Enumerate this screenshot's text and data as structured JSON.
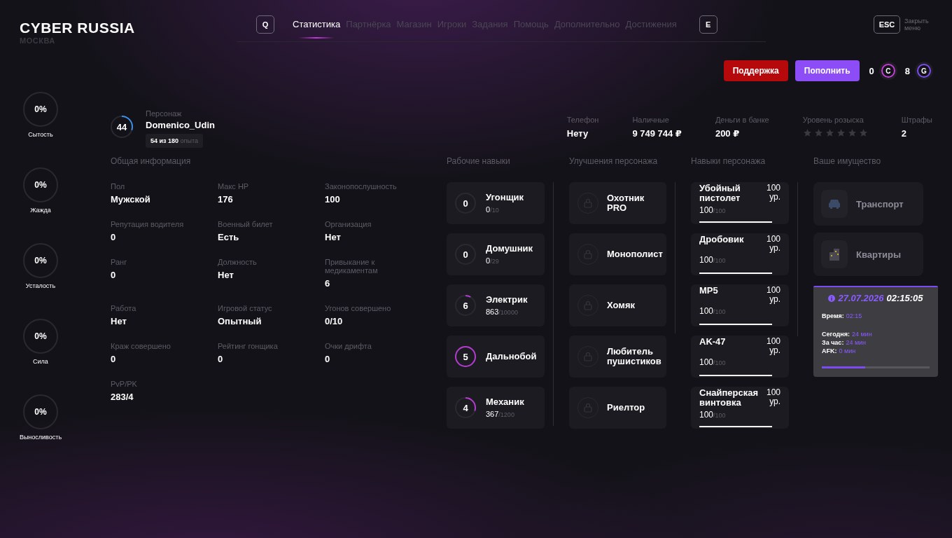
{
  "header": {
    "logo": "CYBER RUSSIA",
    "city": "МОСКВА",
    "prev_key": "Q",
    "next_key": "E",
    "close_key": "ESC",
    "close_label": "Закрыть меню",
    "tabs": [
      {
        "label": "Статистика",
        "selected": true
      },
      {
        "label": "Партнёрка",
        "selected": false
      },
      {
        "label": "Магазин",
        "selected": false
      },
      {
        "label": "Игроки",
        "selected": false
      },
      {
        "label": "Задания",
        "selected": false
      },
      {
        "label": "Помощь",
        "selected": false
      },
      {
        "label": "Дополнительно",
        "selected": false
      },
      {
        "label": "Достижения",
        "selected": false
      }
    ]
  },
  "actions": {
    "support": "Поддержка",
    "topup": "Пополнить",
    "currencies": [
      {
        "amount": "0",
        "symbol": "C",
        "color": "#c43bd8"
      },
      {
        "amount": "8",
        "symbol": "G",
        "color": "#7c4ef2"
      }
    ]
  },
  "needs": [
    {
      "value": "0%",
      "label": "Сытость",
      "level": 0
    },
    {
      "value": "0%",
      "label": "Жажда",
      "level": 0
    },
    {
      "value": "0%",
      "label": "Усталость",
      "level": 0
    },
    {
      "value": "0%",
      "label": "Сила",
      "level": 0
    },
    {
      "value": "0%",
      "label": "Выносливость",
      "level": 0
    }
  ],
  "character": {
    "label": "Персонаж",
    "name": "Domenico_Udin",
    "level_number": "44",
    "level": 0.3,
    "xp": "54 из 180",
    "xp_unit": "опыта"
  },
  "summary": [
    {
      "kind": "text",
      "label": "Телефон",
      "value": "Нету"
    },
    {
      "kind": "text",
      "label": "Наличные",
      "value": "9 749 744 ₽"
    },
    {
      "kind": "text",
      "label": "Деньги в банке",
      "value": "200 ₽"
    },
    {
      "kind": "stars",
      "label": "Уровень розыска",
      "stars": 0
    },
    {
      "kind": "text",
      "label": "Штрафы",
      "value": "2"
    }
  ],
  "general": {
    "title": "Общая информация",
    "fields": [
      {
        "label": "Пол",
        "value": "Мужской"
      },
      {
        "label": "Макс HP",
        "value": "176"
      },
      {
        "label": "Законопослушность",
        "value": "100"
      },
      {
        "label": "Репутация водителя",
        "value": "0"
      },
      {
        "label": "Военный билет",
        "value": "Есть"
      },
      {
        "label": "Организация",
        "value": "Нет"
      },
      {
        "label": "Ранг",
        "value": "0"
      },
      {
        "label": "Должность",
        "value": "Нет"
      },
      {
        "label": "Привыкание к медикаментам",
        "value": "6"
      },
      {
        "label": "Работа",
        "value": "Нет"
      },
      {
        "label": "Игровой статус",
        "value": "Опытный"
      },
      {
        "label": "Угонов совершено",
        "value": "0/10"
      },
      {
        "label": "Краж совершено",
        "value": "0"
      },
      {
        "label": "Рейтинг гонщика",
        "value": "0"
      },
      {
        "label": "Очки дрифта",
        "value": "0"
      },
      {
        "label": "PvP/PK",
        "value": "283/4"
      }
    ]
  },
  "work_skills": {
    "title": "Рабочие навыки",
    "items": [
      {
        "level_number": "0",
        "name": "Угонщик",
        "progress": "0",
        "max": "/10",
        "level": 0
      },
      {
        "level_number": "0",
        "name": "Домушник",
        "progress": "0",
        "max": "/29",
        "level": 0
      },
      {
        "level_number": "6",
        "name": "Электрик",
        "progress": "863",
        "max": "/10000",
        "level": 0.086
      },
      {
        "level_number": "5",
        "name": "Дальнобой",
        "level": 1
      },
      {
        "level_number": "4",
        "name": "Механик",
        "progress": "367",
        "max": "/1200",
        "level": 0.3
      }
    ]
  },
  "upgrades": {
    "title": "Улучшения персонажа",
    "items": [
      {
        "name": "Охотник PRO",
        "locked": true
      },
      {
        "name": "Монополист",
        "locked": true
      },
      {
        "name": "Хомяк",
        "locked": true
      },
      {
        "name": "Любитель пушистиков",
        "locked": true
      },
      {
        "name": "Риелтор",
        "locked": true
      }
    ]
  },
  "char_skills": {
    "title": "Навыки персонажа",
    "items": [
      {
        "name": "Убойный пистолет",
        "grade": "100 ур.",
        "progress": "100",
        "max": "/100",
        "level": 1
      },
      {
        "name": "Дробовик",
        "grade": "100 ур.",
        "progress": "100",
        "max": "/100",
        "level": 1
      },
      {
        "name": "MP5",
        "grade": "100 ур.",
        "progress": "100",
        "max": "/100",
        "level": 1
      },
      {
        "name": "AK-47",
        "grade": "100 ур.",
        "progress": "100",
        "max": "/100",
        "level": 1
      },
      {
        "name": "Снайперская винтовка",
        "grade": "100 ур.",
        "progress": "100",
        "max": "/100",
        "level": 1
      }
    ]
  },
  "property": {
    "title": "Ваше имущество",
    "items": [
      {
        "kind": "vehicle",
        "name": "Транспорт"
      },
      {
        "kind": "apartment",
        "name": "Квартиры"
      }
    ]
  },
  "tooltip": {
    "date": "27.07.2026",
    "time": "02:15:05",
    "session": {
      "label": "Время:",
      "value": "02:15"
    },
    "stats": [
      {
        "label": "Сегодня:",
        "value": "24 мин"
      },
      {
        "label": "За час:",
        "value": "24 мин"
      },
      {
        "label": "AFK:",
        "value": "0 мин"
      }
    ],
    "level": 0.4
  }
}
